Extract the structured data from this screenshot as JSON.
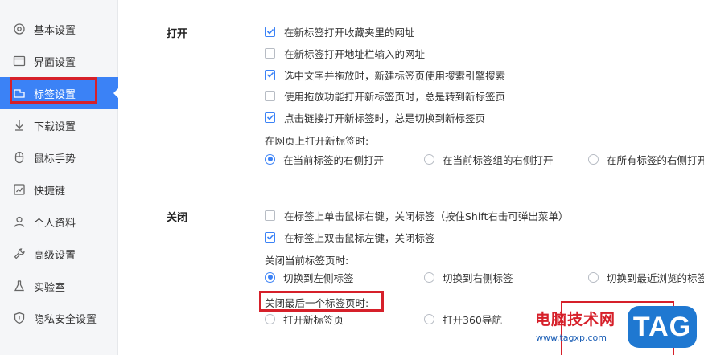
{
  "sidebar": {
    "items": [
      {
        "label": "基本设置",
        "icon": "gear-icon"
      },
      {
        "label": "界面设置",
        "icon": "window-icon"
      },
      {
        "label": "标签设置",
        "icon": "tab-icon"
      },
      {
        "label": "下载设置",
        "icon": "download-icon"
      },
      {
        "label": "鼠标手势",
        "icon": "mouse-icon"
      },
      {
        "label": "快捷键",
        "icon": "shortcut-icon"
      },
      {
        "label": "个人资料",
        "icon": "user-icon"
      },
      {
        "label": "高级设置",
        "icon": "wrench-icon"
      },
      {
        "label": "实验室",
        "icon": "flask-icon"
      },
      {
        "label": "隐私安全设置",
        "icon": "shield-icon"
      }
    ],
    "active_index": 2
  },
  "open_section": {
    "title": "打开",
    "checkboxes": [
      {
        "label": "在新标签打开收藏夹里的网址",
        "checked": true
      },
      {
        "label": "在新标签打开地址栏输入的网址",
        "checked": false
      },
      {
        "label": "选中文字并拖放时，新建标签页使用搜索引擎搜索",
        "checked": true
      },
      {
        "label": "使用拖放功能打开新标签页时，总是转到新标签页",
        "checked": false
      },
      {
        "label": "点击链接打开新标签时，总是切换到新标签页",
        "checked": true
      }
    ],
    "position_label": "在网页上打开新标签时:",
    "position_options": [
      {
        "label": "在当前标签的右侧打开",
        "checked": true
      },
      {
        "label": "在当前标签组的右侧打开",
        "checked": false
      },
      {
        "label": "在所有标签的右侧打开",
        "checked": false
      }
    ]
  },
  "close_section": {
    "title": "关闭",
    "checkboxes": [
      {
        "label": "在标签上单击鼠标右键，关闭标签（按住Shift右击可弹出菜单）",
        "checked": false
      },
      {
        "label": "在标签上双击鼠标左键，关闭标签",
        "checked": true
      }
    ],
    "current_label": "关闭当前标签页时:",
    "current_options": [
      {
        "label": "切换到左侧标签",
        "checked": true
      },
      {
        "label": "切换到右侧标签",
        "checked": false
      },
      {
        "label": "切换到最近浏览的标签",
        "checked": false
      }
    ],
    "last_label": "关闭最后一个标签页时:",
    "last_options": [
      {
        "label": "打开新标签页",
        "checked": false
      },
      {
        "label": "打开360导航",
        "checked": false
      }
    ]
  },
  "watermark": {
    "title": "电脑技术网",
    "url": "www.tagxp.com",
    "logo": "TAG"
  },
  "colors": {
    "accent": "#3b82f6",
    "highlight_red": "#d6202a",
    "sidebar_bg": "#f5f6f8"
  }
}
